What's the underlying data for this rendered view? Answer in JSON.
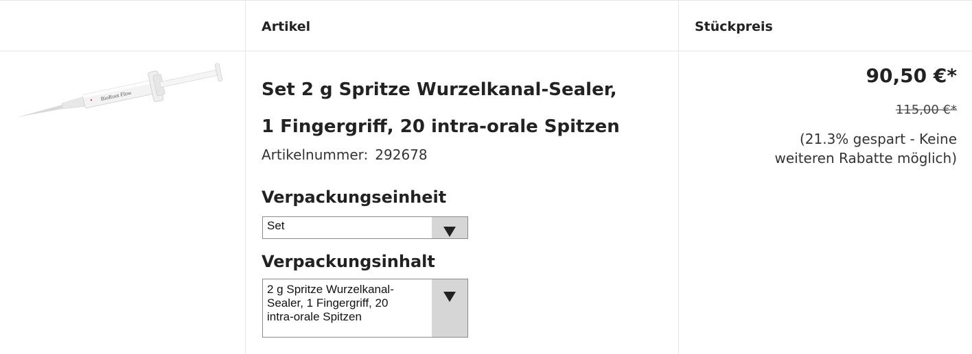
{
  "header": {
    "col_article": "Artikel",
    "col_unit_price": "Stückpreis"
  },
  "product": {
    "title_line1": "Set 2 g Spritze Wurzelkanal-Sealer,",
    "title_line2": "1 Fingergriff, 20 intra-orale Spitzen",
    "article_number_label": "Artikelnummer:",
    "article_number": "292678",
    "image_icon": "syringe-product-image",
    "image_label": "BioRoot Flow"
  },
  "options": {
    "packaging_unit_label": "Verpackungseinheit",
    "packaging_unit_value": "Set",
    "packaging_content_label": "Verpackungsinhalt",
    "packaging_content_value_line1": "2 g Spritze Wurzelkanal-",
    "packaging_content_value_line2": "Sealer, 1 Fingergriff, 20",
    "packaging_content_value_line3": "intra-orale Spitzen"
  },
  "pricing": {
    "price": "90,50 €*",
    "old_price": "115,00 €*",
    "saved_line1": "(21.3% gespart - Keine",
    "saved_line2": "weiteren Rabatte möglich)"
  },
  "colors": {
    "border": "#e6e6e6",
    "select_button": "#d6d6d6",
    "text": "#222222"
  }
}
